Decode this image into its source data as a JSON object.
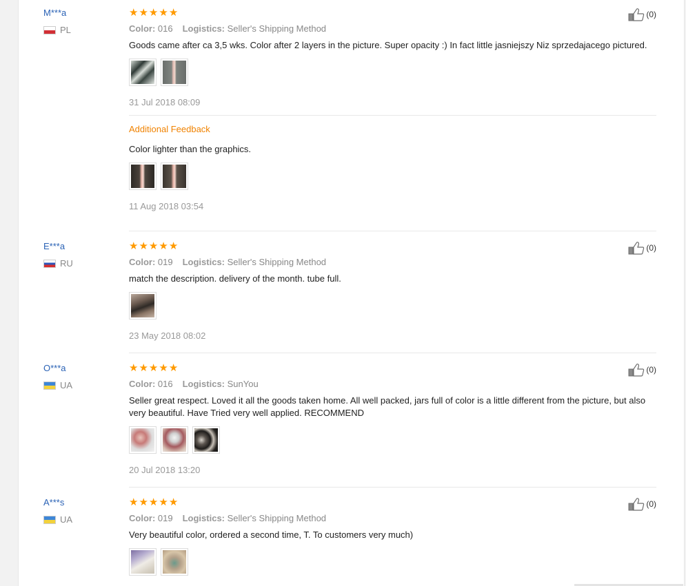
{
  "reviews": [
    {
      "user": "M***a",
      "country": "PL",
      "flag": "pl",
      "stars": 5,
      "color_label": "Color:",
      "color_value": "016",
      "logistics_label": "Logistics:",
      "logistics_value": "Seller's Shipping Method",
      "text": "Goods came after ca 3,5 wks. Color after 2 layers in the picture. Super opacity :) In fact little jasniejszy Niz sprzedajacego pictured.",
      "image_count": 2,
      "date": "31 Jul 2018 08:09",
      "likes": "(0)",
      "additional": {
        "title": "Additional Feedback",
        "text": "Color lighter than the graphics.",
        "image_count": 2,
        "date": "11 Aug 2018 03:54"
      }
    },
    {
      "user": "E***a",
      "country": "RU",
      "flag": "ru",
      "stars": 5,
      "color_label": "Color:",
      "color_value": "019",
      "logistics_label": "Logistics:",
      "logistics_value": "Seller's Shipping Method",
      "text": "match the description. delivery of the month. tube full.",
      "image_count": 1,
      "date": "23 May 2018 08:02",
      "likes": "(0)"
    },
    {
      "user": "O***a",
      "country": "UA",
      "flag": "ua",
      "stars": 5,
      "color_label": "Color:",
      "color_value": "016",
      "logistics_label": "Logistics:",
      "logistics_value": "SunYou",
      "text": "Seller great respect. Loved it all the goods taken home. All well packed, jars full of color is a little different from the picture, but also very beautiful. Have Tried very well applied. RECOMMEND",
      "image_count": 3,
      "date": "20 Jul 2018 13:20",
      "likes": "(0)"
    },
    {
      "user": "A***s",
      "country": "UA",
      "flag": "ua",
      "stars": 5,
      "color_label": "Color:",
      "color_value": "019",
      "logistics_label": "Logistics:",
      "logistics_value": "Seller's Shipping Method",
      "text": "Very beautiful color, ordered a second time, T. To customers very much)",
      "image_count": 2,
      "likes": "(0)"
    }
  ],
  "colors": {
    "user_link": "#2a62b5",
    "star": "#ff9a00",
    "additional_title": "#f08200"
  },
  "icons": {
    "like": "thumbs-up-icon",
    "star": "star-icon"
  }
}
